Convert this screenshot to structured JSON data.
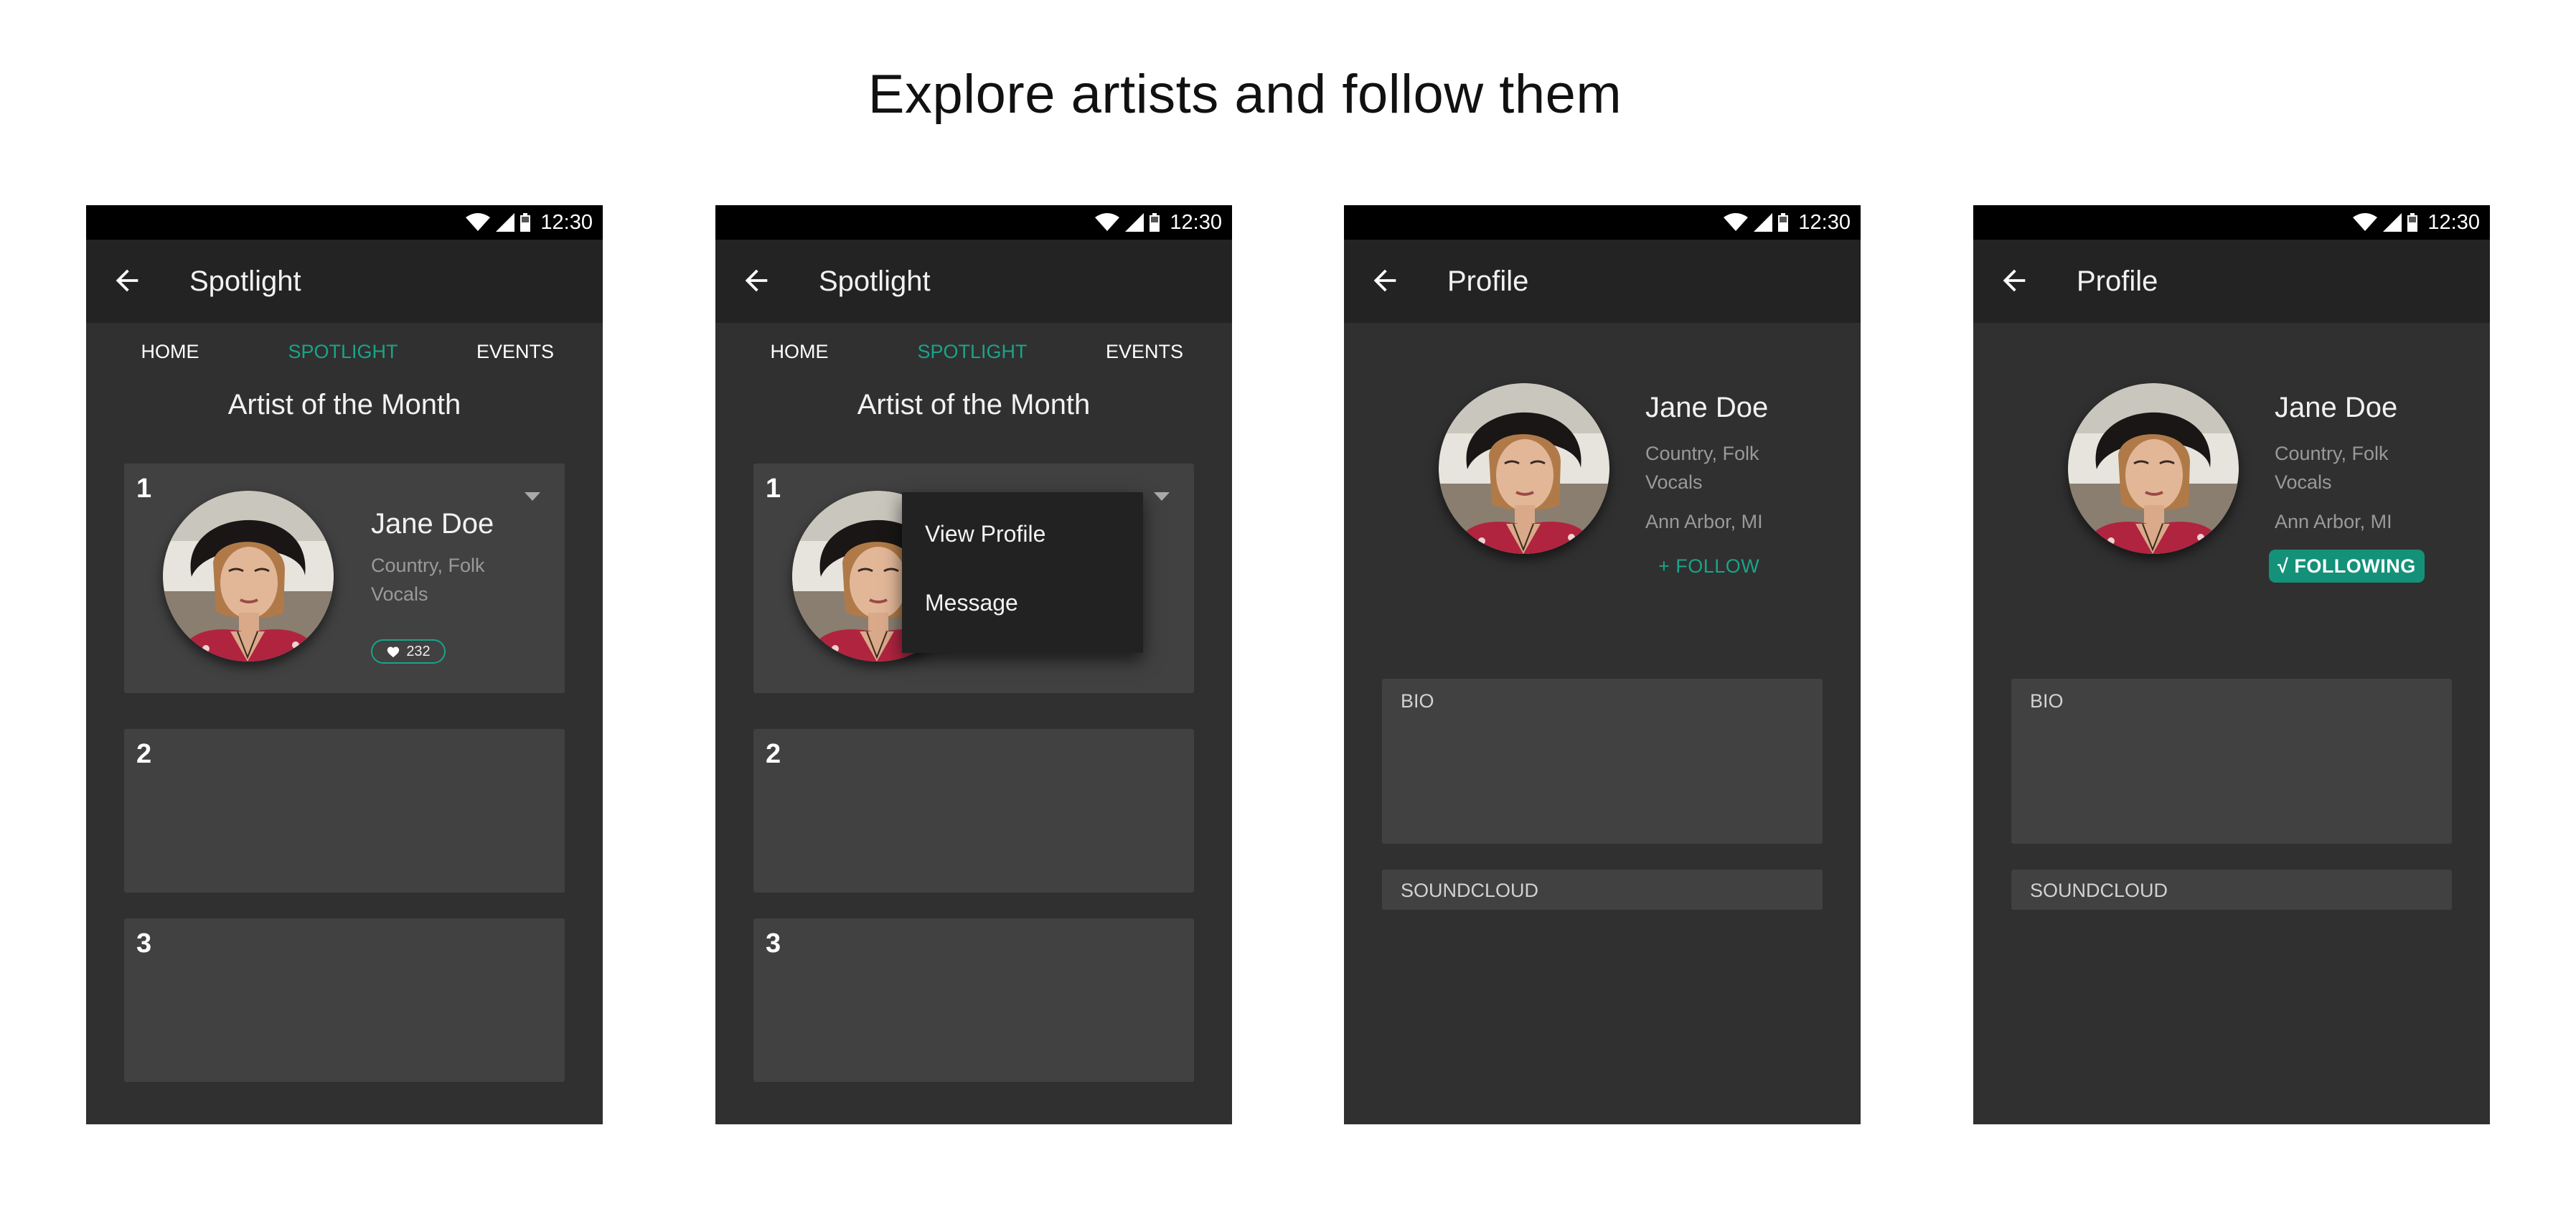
{
  "page": {
    "title": "Explore artists and follow them"
  },
  "status_bar": {
    "time": "12:30"
  },
  "colors": {
    "accent": "#1aa389",
    "following_bg": "#149179",
    "background": "#303030",
    "toolbar": "#232323",
    "card": "#414141",
    "menu": "#222222"
  },
  "icons": {
    "back": "arrow-left-icon",
    "wifi": "wifi-icon",
    "signal": "signal-icon",
    "battery": "battery-icon",
    "heart": "heart-icon",
    "caret": "caret-down-icon"
  },
  "screens": [
    {
      "toolbar_title": "Spotlight",
      "tabs": [
        {
          "label": "HOME"
        },
        {
          "label": "SPOTLIGHT"
        },
        {
          "label": "EVENTS"
        }
      ],
      "section_title": "Artist of the Month",
      "cards": [
        {
          "rank": "1",
          "name": "Jane Doe",
          "genre": "Country, Folk Vocals",
          "likes": "232"
        },
        {
          "rank": "2"
        },
        {
          "rank": "3"
        }
      ]
    },
    {
      "toolbar_title": "Spotlight",
      "tabs": [
        {
          "label": "HOME"
        },
        {
          "label": "SPOTLIGHT"
        },
        {
          "label": "EVENTS"
        }
      ],
      "section_title": "Artist of the Month",
      "cards": [
        {
          "rank": "1"
        },
        {
          "rank": "2"
        },
        {
          "rank": "3"
        }
      ],
      "menu": [
        {
          "label": "View Profile"
        },
        {
          "label": "Message"
        }
      ]
    },
    {
      "toolbar_title": "Profile",
      "name": "Jane Doe",
      "genre": "Country, Folk Vocals",
      "location": "Ann Arbor, MI",
      "action": "+ FOLLOW",
      "sections": [
        {
          "label": "BIO"
        },
        {
          "label": "SOUNDCLOUD"
        }
      ]
    },
    {
      "toolbar_title": "Profile",
      "name": "Jane Doe",
      "genre": "Country, Folk Vocals",
      "location": "Ann Arbor, MI",
      "action": "√ FOLLOWING",
      "sections": [
        {
          "label": "BIO"
        },
        {
          "label": "SOUNDCLOUD"
        }
      ]
    }
  ]
}
